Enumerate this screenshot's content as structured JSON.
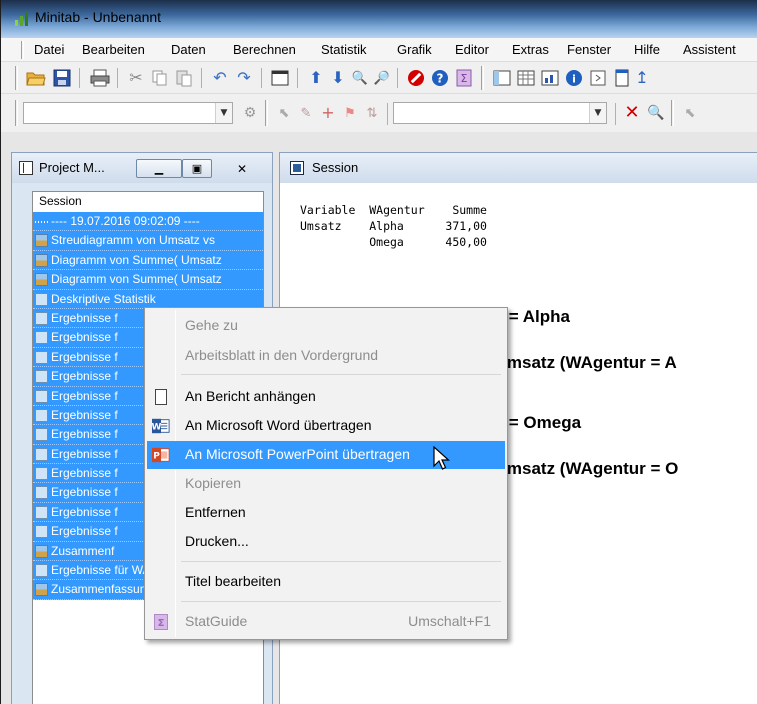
{
  "window": {
    "title": "Minitab - Unbenannt"
  },
  "menubar": {
    "items": [
      "Datei",
      "Bearbeiten",
      "Daten",
      "Berechnen",
      "Statistik",
      "Grafik",
      "Editor",
      "Extras",
      "Fenster",
      "Hilfe",
      "Assistent"
    ]
  },
  "toolbar": {
    "icons": [
      "open-icon",
      "save-icon",
      "print-icon",
      "cut-icon",
      "copy-icon",
      "paste-icon",
      "undo-icon",
      "redo-icon",
      "window-icon",
      "arrow-up-icon",
      "arrow-down-icon",
      "find-icon",
      "find-next-icon",
      "cancel-icon",
      "help-icon",
      "statguide-icon"
    ],
    "colors": {
      "cancel": "#d40000",
      "help": "#1f5fbf",
      "accent": "#3399ff"
    }
  },
  "project_manager": {
    "title": "Project M...",
    "list_header": "Session",
    "items": [
      {
        "icon": "separator",
        "label": "----  19.07.2016 09:02:09  ----"
      },
      {
        "icon": "graph",
        "label": "Streudiagramm von Umsatz vs"
      },
      {
        "icon": "graph",
        "label": "Diagramm von Summe( Umsatz"
      },
      {
        "icon": "graph",
        "label": "Diagramm von Summe( Umsatz"
      },
      {
        "icon": "doc",
        "label": "Deskriptive Statistik"
      },
      {
        "icon": "doc",
        "label": "Ergebnisse f"
      },
      {
        "icon": "doc",
        "label": "Ergebnisse f"
      },
      {
        "icon": "doc",
        "label": "Ergebnisse f"
      },
      {
        "icon": "doc",
        "label": "Ergebnisse f"
      },
      {
        "icon": "doc",
        "label": "Ergebnisse f"
      },
      {
        "icon": "doc",
        "label": "Ergebnisse f"
      },
      {
        "icon": "doc",
        "label": "Ergebnisse f"
      },
      {
        "icon": "doc",
        "label": "Ergebnisse f"
      },
      {
        "icon": "doc",
        "label": "Ergebnisse f"
      },
      {
        "icon": "doc",
        "label": "Ergebnisse f"
      },
      {
        "icon": "doc",
        "label": "Ergebnisse f"
      },
      {
        "icon": "doc",
        "label": "Ergebnisse f"
      },
      {
        "icon": "graph",
        "label": "Zusammenf"
      },
      {
        "icon": "doc",
        "label": "Ergebnisse für WAgentur = O"
      },
      {
        "icon": "graph",
        "label": "Zusammenfassung für Umsat"
      }
    ]
  },
  "session": {
    "title": "Session",
    "table_line1": "Variable  WAgentur    Summe",
    "table_line2": "Umsatz    Alpha      371,00",
    "table_line3": "          Omega      450,00",
    "heading1": "Ergebnisse für WAgentur = Alpha",
    "heading2": "Deskriptive Statistik für Umsatz (WAgentur = A",
    "heading3": "Ergebnisse für WAgentur = Omega",
    "heading4": "Deskriptive Statistik für Umsatz (WAgentur = O"
  },
  "context_menu": {
    "goto": "Gehe zu",
    "to_front": "Arbeitsblatt in den Vordergrund",
    "append_report": "An Bericht anhängen",
    "send_word": "An Microsoft Word übertragen",
    "send_ppt": "An Microsoft PowerPoint übertragen",
    "copy": "Kopieren",
    "remove": "Entfernen",
    "print": "Drucken...",
    "edit_title": "Titel bearbeiten",
    "statguide": "StatGuide",
    "statguide_shortcut": "Umschalt+F1"
  }
}
